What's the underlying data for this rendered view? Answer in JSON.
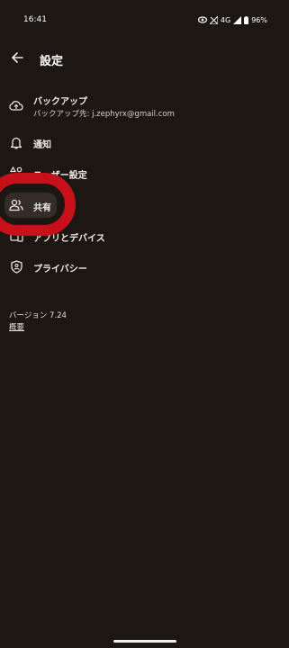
{
  "status_bar": {
    "time": "16:41",
    "network": "4G",
    "battery": "96%"
  },
  "header": {
    "title": "設定",
    "back_icon": "arrow-left-icon"
  },
  "menu": {
    "items": [
      {
        "label": "バックアップ",
        "sublabel": "バックアップ先: j.zephyrx@gmail.com",
        "icon": "cloud-upload-icon"
      },
      {
        "label": "通知",
        "icon": "bell-icon"
      },
      {
        "label": "ユーザー設定",
        "icon": "shapes-icon"
      },
      {
        "label": "共有",
        "icon": "people-icon",
        "selected": true
      },
      {
        "label": "アプリとデバイス",
        "icon": "devices-icon"
      },
      {
        "label": "プライバシー",
        "icon": "shield-icon"
      }
    ]
  },
  "footer": {
    "version": "バージョン 7.24",
    "about_link": "概要"
  },
  "colors": {
    "background": "#1c1713",
    "selected_pill": "#342c26",
    "highlight_ring": "#c8101a"
  }
}
